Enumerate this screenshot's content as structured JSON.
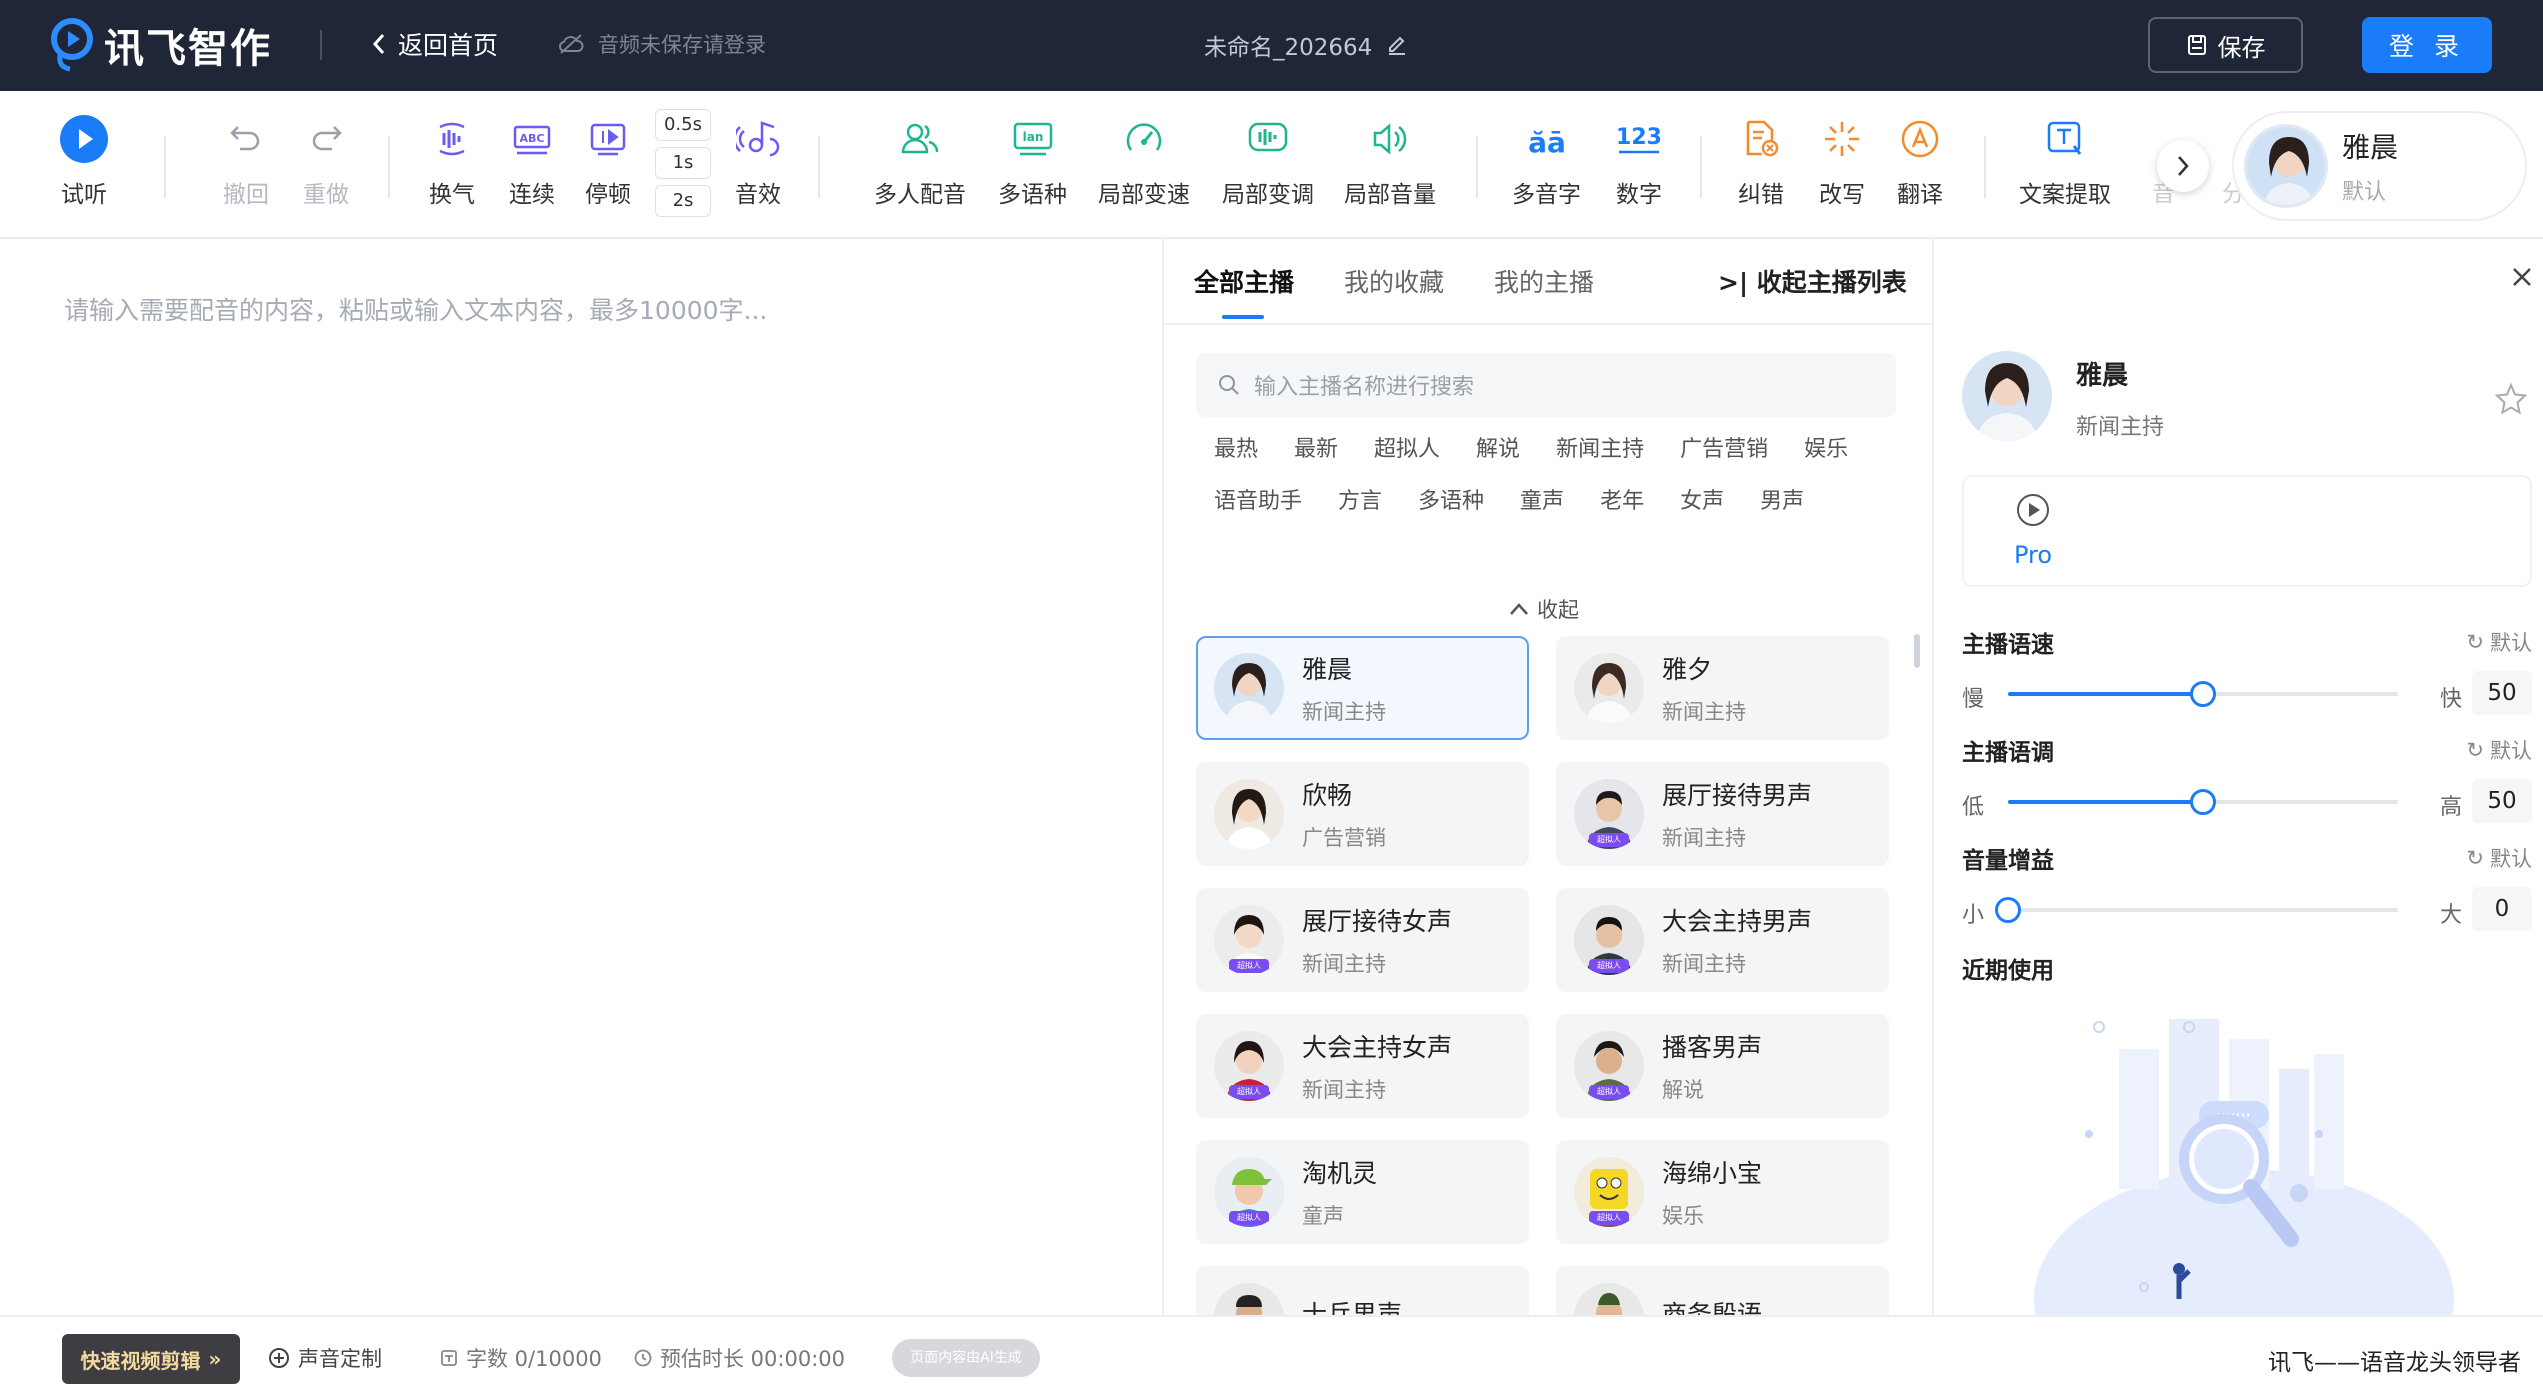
{
  "header": {
    "brand": "讯飞智作",
    "back_label": "返回首页",
    "cloud_notice": "音频未保存请登录",
    "doc_name": "未命名_202664",
    "save_label": "保存",
    "login_label": "登 录",
    "bg_color": "#1f2637",
    "accent_color": "#1a7cf7"
  },
  "toolbar": {
    "preview": "试听",
    "undo": "撤回",
    "redo": "重做",
    "breath": "换气",
    "continuous": "连续",
    "pause": "停顿",
    "pause_options": [
      "0.5s",
      "1s",
      "2s"
    ],
    "sound_effect": "音效",
    "multi_voice": "多人配音",
    "multi_lang": "多语种",
    "local_speed": "局部变速",
    "local_pitch": "局部变调",
    "local_volume": "局部音量",
    "polyphone": "多音字",
    "number": "数字",
    "correct": "纠错",
    "rewrite": "改写",
    "translate": "翻译",
    "extract": "文案提取",
    "cut_off_1": "音",
    "cut_off_2": "分",
    "current_speaker": {
      "name": "雅晨",
      "sub": "默认"
    }
  },
  "editor": {
    "placeholder": "请输入需要配音的内容，粘贴或输入文本内容，最多10000字..."
  },
  "speaker_panel": {
    "tabs": [
      "全部主播",
      "我的收藏",
      "我的主播"
    ],
    "collapse_list": "收起主播列表",
    "search_placeholder": "输入主播名称进行搜索",
    "categories": [
      "最热",
      "最新",
      "超拟人",
      "解说",
      "新闻主持",
      "广告营销",
      "娱乐",
      "语音助手",
      "方言",
      "多语种",
      "童声",
      "老年",
      "女声",
      "男声"
    ],
    "fold_label": "收起",
    "badge_text": "超拟人",
    "speakers": [
      {
        "name": "雅晨",
        "tag": "新闻主持"
      },
      {
        "name": "雅夕",
        "tag": "新闻主持"
      },
      {
        "name": "欣畅",
        "tag": "广告营销"
      },
      {
        "name": "展厅接待男声",
        "tag": "新闻主持"
      },
      {
        "name": "展厅接待女声",
        "tag": "新闻主持"
      },
      {
        "name": "大会主持男声",
        "tag": "新闻主持"
      },
      {
        "name": "大会主持女声",
        "tag": "新闻主持"
      },
      {
        "name": "播客男声",
        "tag": "解说"
      },
      {
        "name": "淘机灵",
        "tag": "童声"
      },
      {
        "name": "海绵小宝",
        "tag": "娱乐"
      },
      {
        "name": "士兵男声",
        "tag": ""
      },
      {
        "name": "商务殷语",
        "tag": ""
      }
    ]
  },
  "detail": {
    "name": "雅晨",
    "sub": "新闻主持",
    "pro_label": "Pro",
    "reset_label": "默认",
    "speed": {
      "title": "主播语速",
      "low": "慢",
      "high": "快",
      "value": "50",
      "fraction": 0.5
    },
    "pitch": {
      "title": "主播语调",
      "low": "低",
      "high": "高",
      "value": "50",
      "fraction": 0.5
    },
    "volume": {
      "title": "音量增益",
      "low": "小",
      "high": "大",
      "value": "0",
      "fraction": 0.0
    },
    "recent_title": "近期使用"
  },
  "footer": {
    "quick_edit": "快速视频剪辑",
    "voice_custom": "声音定制",
    "char_count": "字数 0/10000",
    "est_duration": "预估时长 00:00:00",
    "ai_tag": "页面内容由AI生成",
    "slogan": "讯飞——语音龙头领导者"
  }
}
